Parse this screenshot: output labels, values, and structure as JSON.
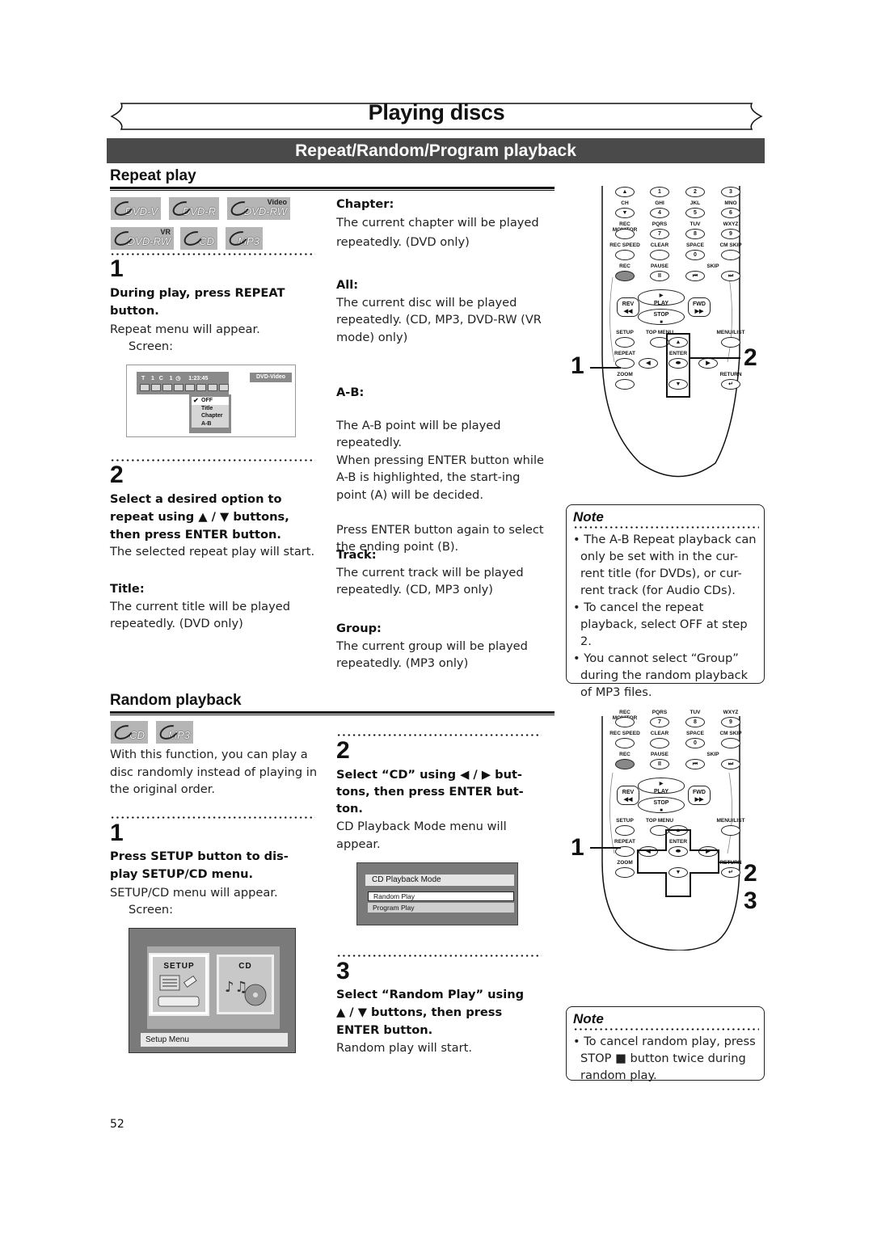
{
  "header": {
    "title": "Playing discs",
    "section": "Repeat/Random/Program playback"
  },
  "repeat": {
    "heading": "Repeat play",
    "discs": [
      {
        "label": "DVD-V",
        "sup": ""
      },
      {
        "label": "DVD-R",
        "sup": ""
      },
      {
        "label": "DVD-RW",
        "sup": "Video"
      },
      {
        "label": "DVD-RW",
        "sup": "VR"
      },
      {
        "label": "CD",
        "sup": ""
      },
      {
        "label": "MP3",
        "sup": ""
      }
    ],
    "step1": {
      "num": "1",
      "instruction": "During play, press REPEAT button.",
      "desc": "Repeat menu will appear.",
      "screen_label": "Screen:"
    },
    "osd": {
      "status": "T    1   C    1  ◷     1:23:45",
      "disc_type": "DVD-Video",
      "menu": [
        {
          "label": "OFF",
          "selected": true
        },
        {
          "label": "Title",
          "selected": false
        },
        {
          "label": "Chapter",
          "selected": false
        },
        {
          "label": "A-B",
          "selected": false
        }
      ]
    },
    "step2": {
      "num": "2",
      "instruction": "Select a desired option to repeat using ▲ / ▼ buttons, then press ENTER button.",
      "desc": "The selected repeat play will start."
    },
    "options": [
      {
        "name": "Title:",
        "desc": "The current title will be played repeatedly. (DVD only)"
      },
      {
        "name": "Chapter:",
        "desc": "The current chapter will be played repeatedly. (DVD only)"
      },
      {
        "name": "All:",
        "desc": "The current disc will be played repeatedly. (CD, MP3, DVD-RW (VR mode) only)"
      },
      {
        "name": "A-B:",
        "desc": "The A-B point will be played repeatedly.\nWhen pressing ENTER button while A-B is highlighted, the start-ing point (A) will be decided.\n\nPress ENTER button again to select the ending point (B)."
      },
      {
        "name": "Track:",
        "desc": "The current track will be played repeatedly. (CD, MP3 only)"
      },
      {
        "name": "Group:",
        "desc": "The current group will be played repeatedly. (MP3 only)"
      }
    ],
    "note": {
      "title": "Note",
      "items": [
        "The A-B Repeat playback can only be set with in the cur-rent title (for DVDs), or cur-rent track (for Audio CDs).",
        "To cancel the repeat playback, select OFF at step 2.",
        "You cannot select “Group” during the random playback of MP3 files."
      ]
    },
    "callouts": [
      "1",
      "2"
    ]
  },
  "remote": {
    "rows": [
      [
        {
          "top": "",
          "btn": "▲"
        },
        {
          "top": "",
          "btn": "1"
        },
        {
          "top": "",
          "btn": "2"
        },
        {
          "top": "",
          "btn": "3"
        }
      ],
      [
        {
          "top": "CH",
          "btn": "▼"
        },
        {
          "top": "GHI",
          "btn": "4"
        },
        {
          "top": "JKL",
          "btn": "5"
        },
        {
          "top": "MNO",
          "btn": "6"
        }
      ],
      [
        {
          "top": "REC MONITOR",
          "btn": ""
        },
        {
          "top": "PQRS",
          "btn": "7"
        },
        {
          "top": "TUV",
          "btn": "8"
        },
        {
          "top": "WXYZ",
          "btn": "9"
        }
      ],
      [
        {
          "top": "REC SPEED",
          "btn": ""
        },
        {
          "top": "CLEAR",
          "btn": ""
        },
        {
          "top": "SPACE",
          "btn": "0"
        },
        {
          "top": "CM SKIP",
          "btn": ""
        }
      ],
      [
        {
          "top": "REC",
          "btn": ""
        },
        {
          "top": "PAUSE",
          "btn": "II"
        },
        {
          "top": "",
          "btn": "⏮"
        },
        {
          "top": "",
          "btn": "⏭"
        }
      ]
    ],
    "skip_label": "SKIP",
    "transport": {
      "play": "PLAY",
      "stop": "STOP",
      "rev": "REV",
      "fwd": "FWD"
    },
    "nav": {
      "setup": "SETUP",
      "top_menu": "TOP MENU",
      "menu_list": "MENU/LIST",
      "repeat": "REPEAT",
      "enter": "ENTER",
      "zoom": "ZOOM",
      "return": "RETURN"
    }
  },
  "random": {
    "heading": "Random playback",
    "discs": [
      {
        "label": "CD",
        "sup": ""
      },
      {
        "label": "MP3",
        "sup": ""
      }
    ],
    "intro": "With this function, you can play a disc randomly instead of playing in the original order.",
    "step1": {
      "num": "1",
      "instruction": "Press SETUP button to dis-play SETUP/CD menu.",
      "desc": "SETUP/CD menu will appear.",
      "screen_label": "Screen:"
    },
    "setup_screen": {
      "tiles": [
        "SETUP",
        "CD"
      ],
      "caption": "Setup Menu"
    },
    "step2": {
      "num": "2",
      "instruction": "Select “CD” using ◀ / ▶ but-tons, then press ENTER but-ton.",
      "desc": "CD Playback Mode menu will appear."
    },
    "cd_mode": {
      "title": "CD Playback Mode",
      "options": [
        {
          "label": "Random Play",
          "selected": true
        },
        {
          "label": "Program Play",
          "selected": false
        }
      ]
    },
    "step3": {
      "num": "3",
      "instruction": "Select “Random Play” using ▲ / ▼ buttons, then press ENTER button.",
      "desc": "Random play will start."
    },
    "note": {
      "title": "Note",
      "items": [
        "To cancel random play, press STOP ■ button twice during random play."
      ]
    },
    "callouts": [
      "1",
      "2",
      "3"
    ]
  },
  "page_number": "52"
}
